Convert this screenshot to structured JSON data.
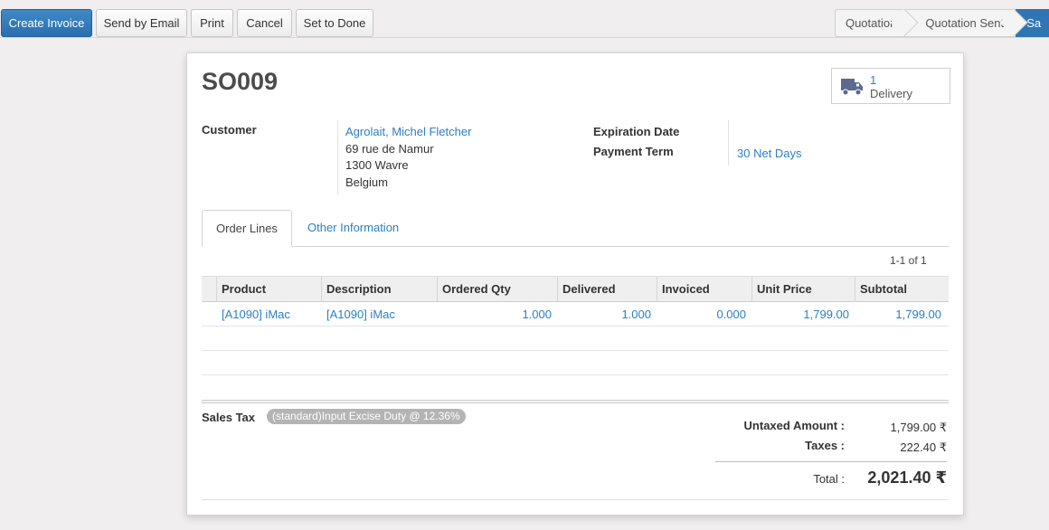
{
  "toolbar": {
    "buttons": {
      "create_invoice": "Create Invoice",
      "send_by_email": "Send by Email",
      "print": "Print",
      "cancel": "Cancel",
      "set_to_done": "Set to Done"
    },
    "status_steps": [
      "Quotation",
      "Quotation Sent",
      "Sa"
    ],
    "active_status_index": 2
  },
  "form": {
    "title": "SO009",
    "smart_button": {
      "count": "1",
      "label": "Delivery",
      "icon": "truck-icon"
    },
    "customer": {
      "label": "Customer",
      "name": "Agrolait, Michel Fletcher",
      "address_line1": "69 rue de Namur",
      "address_line2": "1300 Wavre",
      "address_line3": "Belgium"
    },
    "expiration_date": {
      "label": "Expiration Date",
      "value": ""
    },
    "payment_term": {
      "label": "Payment Term",
      "value": "30 Net Days"
    }
  },
  "tabs": {
    "order_lines": "Order Lines",
    "other_information": "Other Information"
  },
  "pager": "1-1 of 1",
  "table": {
    "columns": [
      "Product",
      "Description",
      "Ordered Qty",
      "Delivered",
      "Invoiced",
      "Unit Price",
      "Subtotal"
    ],
    "rows": [
      {
        "product": "[A1090] iMac",
        "description": "[A1090] iMac",
        "ordered_qty": "1.000",
        "delivered": "1.000",
        "invoiced": "0.000",
        "unit_price": "1,799.00",
        "subtotal": "1,799.00"
      }
    ]
  },
  "sales_tax": {
    "label": "Sales Tax",
    "tag": "(standard)Input Excise Duty @ 12.36%"
  },
  "totals": {
    "untaxed_label": "Untaxed Amount :",
    "untaxed_value": "1,799.00 ₹",
    "taxes_label": "Taxes :",
    "taxes_value": "222.40 ₹",
    "total_label": "Total :",
    "total_value": "2,021.40 ₹"
  },
  "colors": {
    "primary": "#2f75b3",
    "link": "#2c7fc4",
    "background": "#f0eeee"
  }
}
